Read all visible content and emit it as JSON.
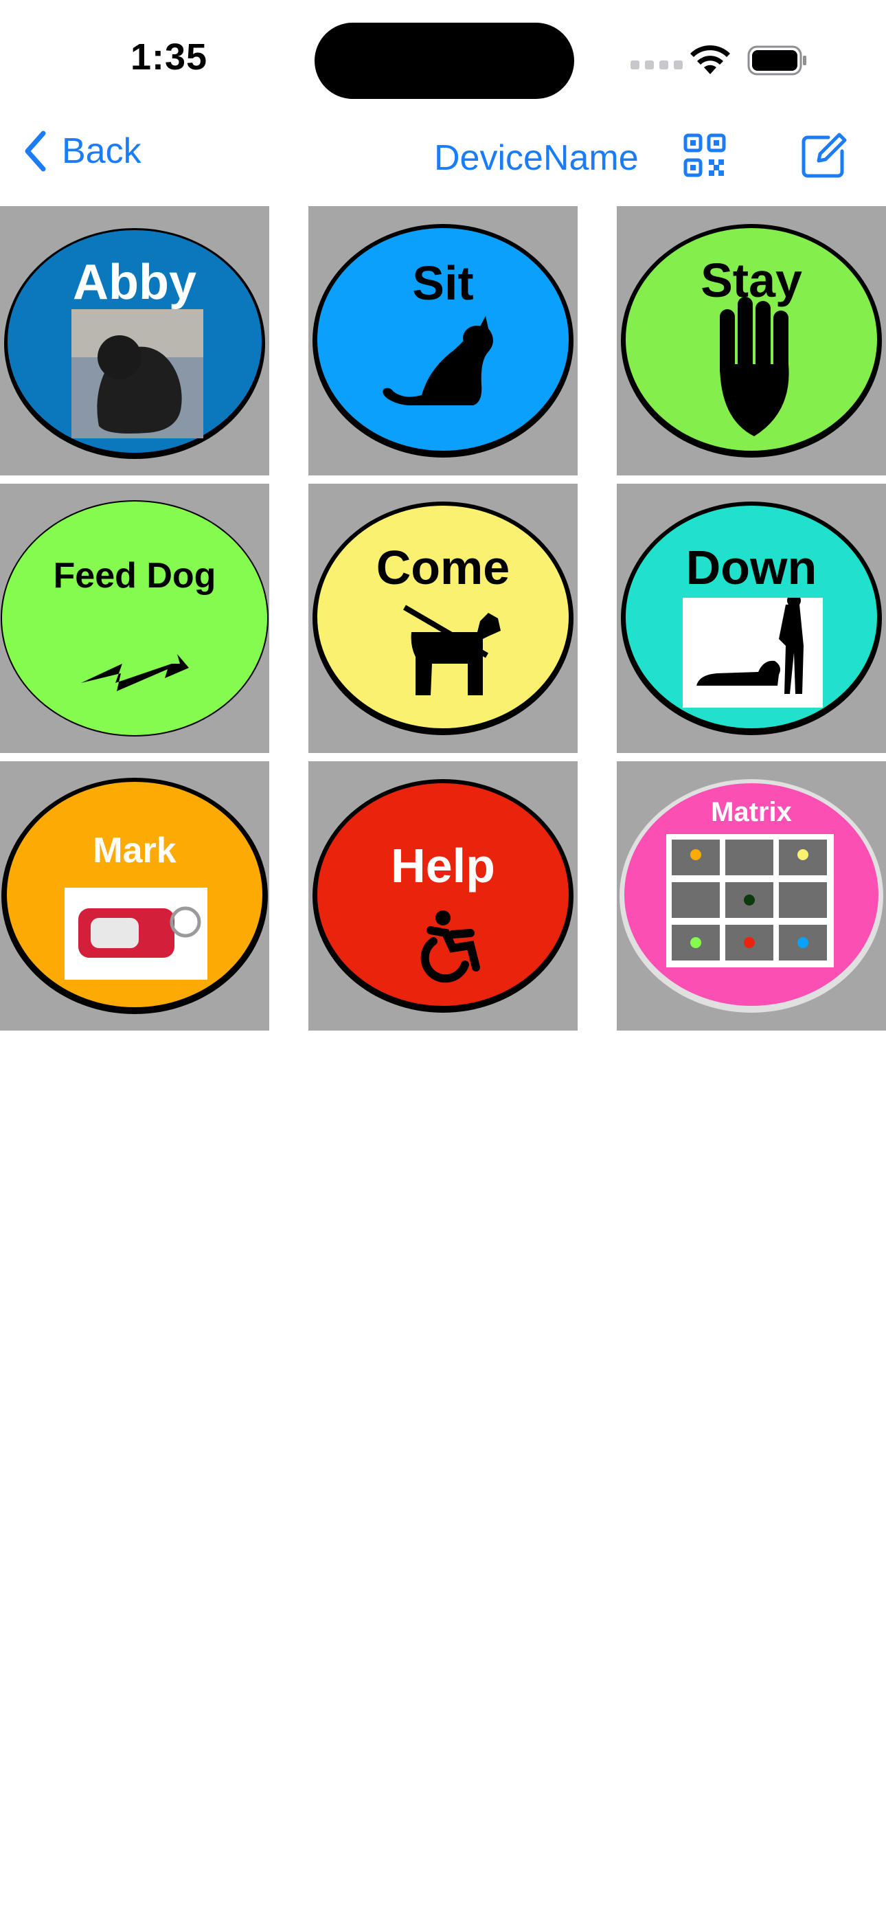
{
  "status_bar": {
    "time": "1:35"
  },
  "nav": {
    "back_label": "Back",
    "title": "DeviceName",
    "qr_icon": "qrcode-icon",
    "edit_icon": "square-and-pencil-icon"
  },
  "colors": {
    "accent": "#1b7cf5",
    "tile_background": "#a6a6a6"
  },
  "buttons": [
    {
      "label": "Abby",
      "color": "#0b78be",
      "icon": "dog-photo"
    },
    {
      "label": "Sit",
      "color": "#0ba0fb",
      "icon": "cat-sitting-icon"
    },
    {
      "label": "Stay",
      "color": "#84ef4c",
      "icon": "hand-stop-icon"
    },
    {
      "label": "Feed Dog",
      "color": "#85fa4f",
      "icon": "lightning-bolt-icon"
    },
    {
      "label": "Come",
      "color": "#fbf170",
      "icon": "dog-on-leash-icon"
    },
    {
      "label": "Down",
      "color": "#20e1cc",
      "icon": "dog-lying-down-photo"
    },
    {
      "label": "Mark",
      "color": "#fdaa04",
      "icon": "clicker-photo"
    },
    {
      "label": "Help",
      "color": "#ea230d",
      "icon": "wheelchair-icon"
    },
    {
      "label": "Matrix",
      "color": "#fb4fb3",
      "icon": "matrix-grid-photo"
    }
  ]
}
